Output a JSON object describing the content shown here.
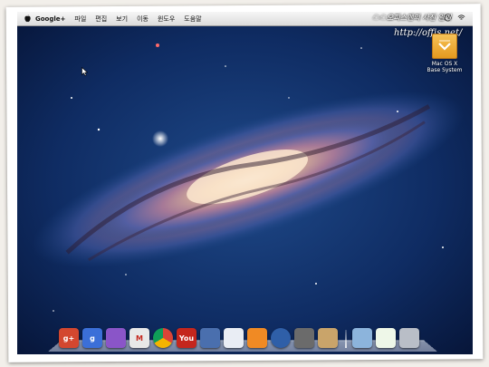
{
  "menubar": {
    "app_name": "Google+",
    "items": [
      "파일",
      "편집",
      "보기",
      "이동",
      "윈도우",
      "도움말"
    ]
  },
  "watermark": {
    "text": "☁☁오피스맨의 사진 일기",
    "url": "http://offis.net/"
  },
  "desktop": {
    "icon_label": "Mac OS X\nBase System"
  },
  "dock": {
    "apps": [
      {
        "name": "google-plus",
        "label": "g+",
        "color": "#d3472f"
      },
      {
        "name": "google-search",
        "label": "g",
        "color": "#3b6fd8"
      },
      {
        "name": "picasa",
        "label": "",
        "color": "#8a55c8"
      },
      {
        "name": "gmail",
        "label": "M",
        "color": "#e8e8e8"
      },
      {
        "name": "chrome",
        "label": "",
        "color": "#ffffff"
      },
      {
        "name": "youtube",
        "label": "You",
        "color": "#c4261d"
      },
      {
        "name": "contacts",
        "label": "",
        "color": "#4a6fae"
      },
      {
        "name": "slides",
        "label": "",
        "color": "#e9edf4"
      },
      {
        "name": "rss-reader",
        "label": "",
        "color": "#f08a24"
      },
      {
        "name": "music",
        "label": "",
        "color": "#2f5fa8"
      },
      {
        "name": "video-reel",
        "label": "",
        "color": "#6b6b6b"
      },
      {
        "name": "photos",
        "label": "",
        "color": "#c9a46a"
      },
      {
        "name": "folder",
        "label": "",
        "color": "#8cb4dc"
      },
      {
        "name": "document",
        "label": "",
        "color": "#eef7e8"
      },
      {
        "name": "trash",
        "label": "",
        "color": "#b9bec7"
      }
    ]
  },
  "colors": {
    "sky": "#0b1f47",
    "galaxy_core": "#f6dcc0",
    "menubar": "#e8e8e8"
  }
}
